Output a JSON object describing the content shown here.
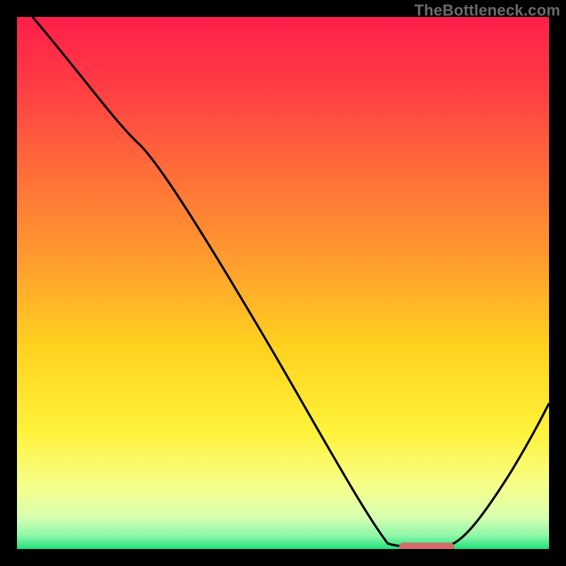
{
  "watermark": "TheBottleneck.com",
  "chart_data": {
    "type": "line",
    "title": "",
    "xlabel": "",
    "ylabel": "",
    "xlim": [
      0,
      100
    ],
    "ylim": [
      0,
      100
    ],
    "grid": false,
    "legend": false,
    "series": [
      {
        "name": "bottleneck-curve",
        "x": [
          3,
          23,
          70,
          80,
          100
        ],
        "y": [
          100,
          76,
          0.5,
          0.5,
          30
        ],
        "color": "#000000"
      }
    ],
    "marker": {
      "name": "optimal-range",
      "x_start": 72,
      "x_end": 82,
      "y": 0.5,
      "color": "#d46a6a"
    },
    "background_gradient_stops": [
      {
        "offset": 0.0,
        "color": "#ff1f4b"
      },
      {
        "offset": 0.12,
        "color": "#ff3a44"
      },
      {
        "offset": 0.28,
        "color": "#ff6a3a"
      },
      {
        "offset": 0.45,
        "color": "#ff9a2f"
      },
      {
        "offset": 0.62,
        "color": "#ffd21f"
      },
      {
        "offset": 0.78,
        "color": "#fff23a"
      },
      {
        "offset": 0.88,
        "color": "#f7ff8a"
      },
      {
        "offset": 0.94,
        "color": "#d8ffb0"
      },
      {
        "offset": 0.975,
        "color": "#8ef7a8"
      },
      {
        "offset": 1.0,
        "color": "#1fe07a"
      }
    ]
  }
}
